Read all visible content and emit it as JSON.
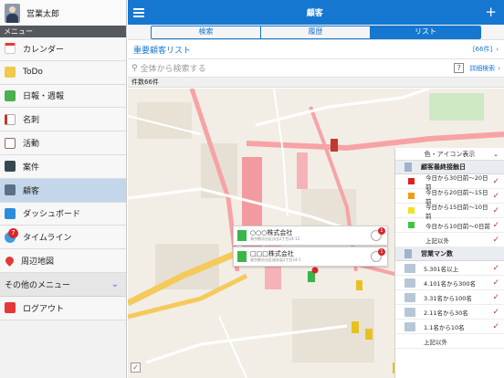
{
  "user": {
    "name": "営業太郎"
  },
  "menu_header": "メニュー",
  "sidebar": {
    "items": [
      {
        "label": "カレンダー",
        "icon": "calendar-icon",
        "color": "#e53935"
      },
      {
        "label": "ToDo",
        "icon": "folder-icon",
        "color": "#f2c94c"
      },
      {
        "label": "日報・週報",
        "icon": "report-icon",
        "color": "#4caf50"
      },
      {
        "label": "名刺",
        "icon": "business-card-icon",
        "color": "#c0392b"
      },
      {
        "label": "活動",
        "icon": "activity-icon",
        "color": "#8d6e63"
      },
      {
        "label": "案件",
        "icon": "deal-icon",
        "color": "#37474f"
      },
      {
        "label": "顧客",
        "icon": "building-icon",
        "color": "#5c6f86",
        "active": true
      },
      {
        "label": "ダッシュボード",
        "icon": "dashboard-icon",
        "color": "#2b8cdc"
      },
      {
        "label": "タイムライン",
        "icon": "timeline-icon",
        "color": "#3aa0e6",
        "badge": "7"
      },
      {
        "label": "周辺地図",
        "icon": "map-pin-icon",
        "color": "#e53935"
      }
    ],
    "other_menu": "その他のメニュー",
    "logout": "ログアウト"
  },
  "header": {
    "title": "顧客"
  },
  "tabs": [
    {
      "label": "検索",
      "active": false
    },
    {
      "label": "履歴",
      "active": false
    },
    {
      "label": "リスト",
      "active": true
    }
  ],
  "list": {
    "title": "重要顧客リスト",
    "count": "[66件]"
  },
  "search": {
    "placeholder": "全体から検索する",
    "help": "?",
    "advanced": "詳細検索"
  },
  "result_count": "件数66件",
  "map": {
    "callouts": [
      {
        "name": "○○○株式会社",
        "address": "東京都渋谷区渋谷2丁目24-12",
        "badge": "1"
      },
      {
        "name": "□□□株式会社",
        "address": "東京都渋谷区道玄坂2丁目24-1",
        "badge": "1"
      }
    ]
  },
  "legend": {
    "title": "色・アイコン表示",
    "section1": "顧客最終接触日",
    "rows1": [
      {
        "label": "今日から30日前〜20日前",
        "color": "#e02020"
      },
      {
        "label": "今日から20日前〜15日前",
        "color": "#f39c12"
      },
      {
        "label": "今日から15日前〜10日前",
        "color": "#f1e21d"
      },
      {
        "label": "今日から10日前〜0日前",
        "color": "#3ec43e"
      },
      {
        "label": "上記以外",
        "color": ""
      }
    ],
    "section2": "営業マン数",
    "rows2": [
      {
        "label": "5.301名以上"
      },
      {
        "label": "4.101名から300名"
      },
      {
        "label": "3.31名から100名"
      },
      {
        "label": "2.11名から30名"
      },
      {
        "label": "1.1名から10名"
      },
      {
        "label": "上記以外"
      }
    ]
  }
}
